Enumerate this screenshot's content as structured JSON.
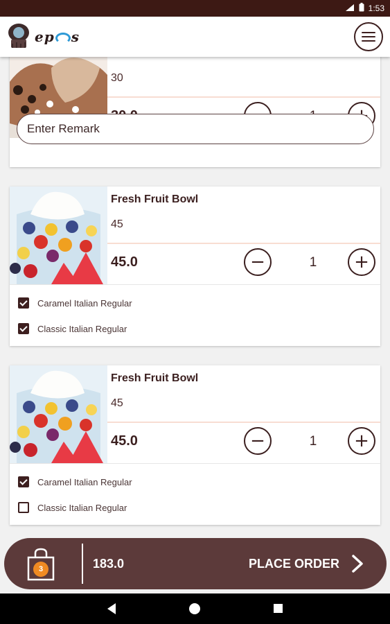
{
  "status_bar": {
    "time": "1:53",
    "signal_icon": "signal-icon",
    "battery_icon": "battery-icon"
  },
  "app_bar": {
    "logo_text_pre": "ep",
    "logo_text_post": "s",
    "menu_icon": "hamburger-menu-icon"
  },
  "cart_items": [
    {
      "name": "",
      "price_small": "30",
      "price_total": "30.0",
      "quantity": "1",
      "remark_placeholder": "Enter Remark",
      "image": "chocolate-sundae"
    },
    {
      "name": "Fresh Fruit Bowl",
      "price_small": "45",
      "price_total": "45.0",
      "quantity": "1",
      "image": "fruit-bowl",
      "options": [
        {
          "label": "Caramel Italian Regular",
          "checked": true
        },
        {
          "label": "Classic Italian Regular",
          "checked": true
        }
      ]
    },
    {
      "name": "Fresh Fruit Bowl",
      "price_small": "45",
      "price_total": "45.0",
      "quantity": "1",
      "image": "fruit-bowl",
      "options": [
        {
          "label": "Caramel Italian Regular",
          "checked": true
        },
        {
          "label": "Classic Italian Regular",
          "checked": false
        }
      ]
    }
  ],
  "order_bar": {
    "cart_count": "3",
    "total": "183.0",
    "place_order_label": "PLACE ORDER"
  },
  "colors": {
    "brand": "#5c3a3a",
    "dark": "#3d1f1f",
    "accent": "#f08a22",
    "divider": "#f8ddd2",
    "status_bar": "#3d1914"
  }
}
